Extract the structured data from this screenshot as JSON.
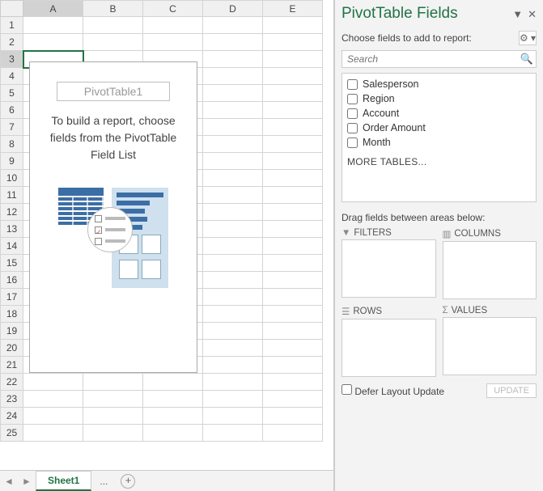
{
  "columns": [
    "A",
    "B",
    "C",
    "D",
    "E"
  ],
  "rowCount": 25,
  "selectedCell": {
    "row": 3,
    "col": "A"
  },
  "pivot": {
    "name": "PivotTable1",
    "hint": "To build a report, choose fields from the PivotTable Field List"
  },
  "tabs": {
    "active": "Sheet1",
    "overflow": "...",
    "add": "+"
  },
  "pane": {
    "title": "PivotTable Fields",
    "subtitle": "Choose fields to add to report:",
    "searchPlaceholder": "Search",
    "fields": [
      "Salesperson",
      "Region",
      "Account",
      "Order Amount",
      "Month"
    ],
    "more": "MORE TABLES...",
    "dragLabel": "Drag fields between areas below:",
    "areas": {
      "filters": "FILTERS",
      "columns": "COLUMNS",
      "rows": "ROWS",
      "values": "VALUES"
    },
    "defer": "Defer Layout Update",
    "update": "UPDATE"
  }
}
